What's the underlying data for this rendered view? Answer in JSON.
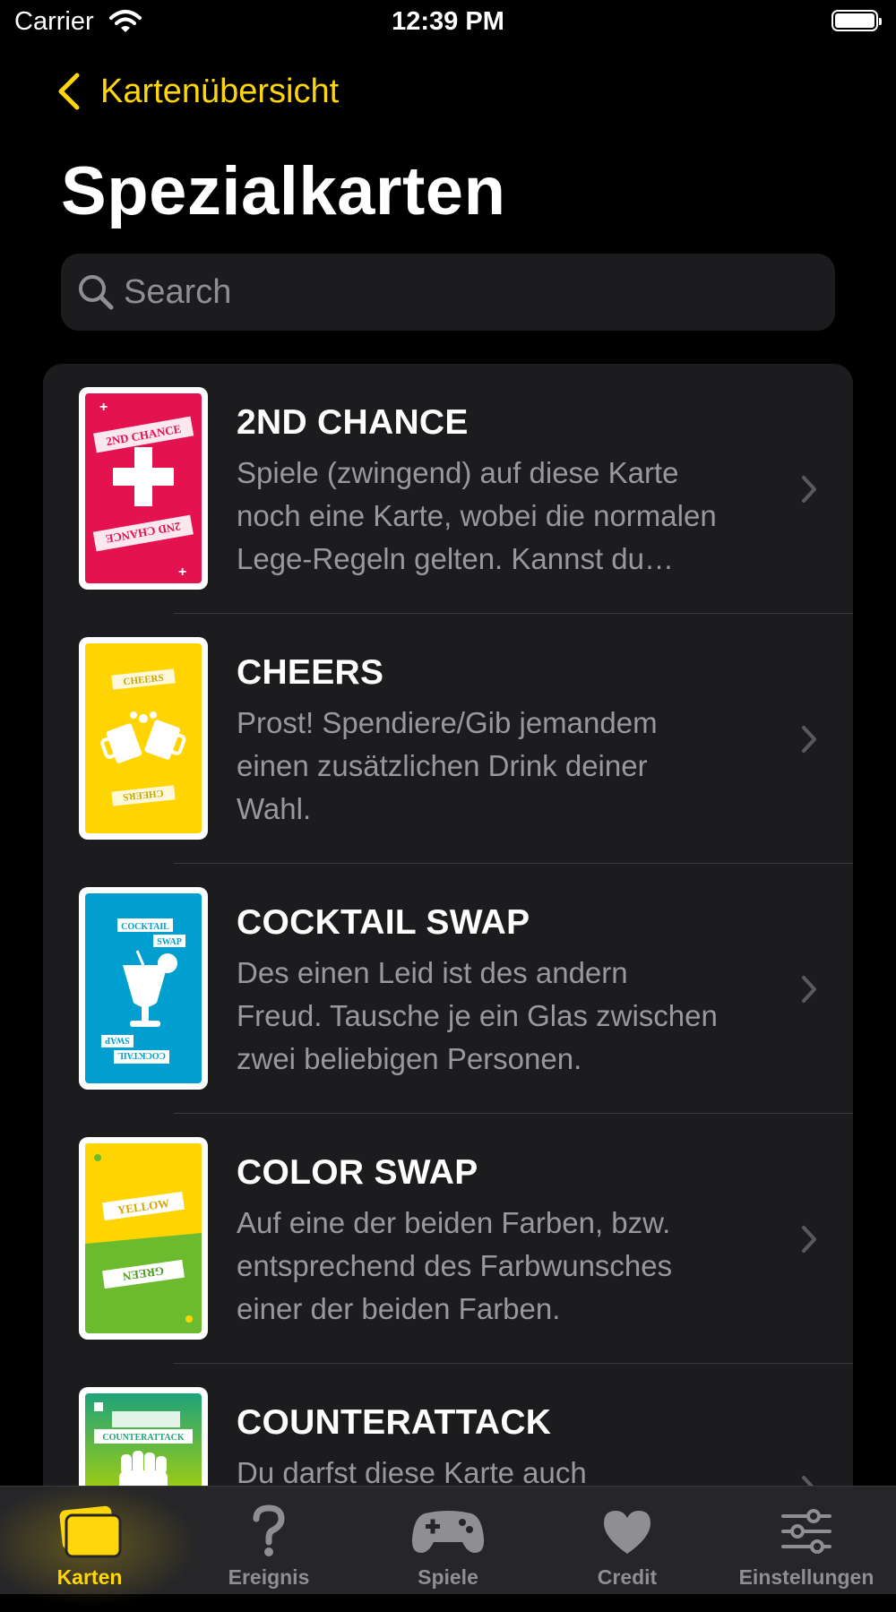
{
  "status_bar": {
    "carrier": "Carrier",
    "time": "12:39 PM"
  },
  "nav": {
    "back_label": "Kartenübersicht",
    "title": "Spezialkarten"
  },
  "search": {
    "placeholder": "Search"
  },
  "colors": {
    "accent": "#FFD60A"
  },
  "cards": [
    {
      "title": "2ND CHANCE",
      "description": "Spiele (zwingend) auf diese Karte noch eine Karte, wobei die normalen Lege-Regeln gelten. Kannst du…",
      "card_color": "#E4134F",
      "banner": "2ND CHANCE",
      "icon": "plus-icon"
    },
    {
      "title": "CHEERS",
      "description": "Prost! Spendiere/Gib jemandem einen zusätzlichen Drink deiner Wahl.",
      "card_color": "#FFD400",
      "banner": "CHEERS",
      "icon": "beer-mugs-icon"
    },
    {
      "title": "COCKTAIL SWAP",
      "description": "Des einen Leid ist des andern Freud. Tausche je ein Glas zwischen zwei beliebigen Personen.",
      "card_color": "#009FCF",
      "banner": "COCKTAIL",
      "banner2": "SWAP",
      "icon": "cocktail-icon"
    },
    {
      "title": "COLOR SWAP",
      "description": "Auf eine der beiden Farben, bzw. entsprechend des Farbwunsches einer der beiden Farben.",
      "card_color": "#FFD400",
      "card_color2": "#6CBB2E",
      "banner": "YELLOW",
      "banner2": "GREEN",
      "icon": "color-split-icon"
    },
    {
      "title": "COUNTERATTACK",
      "description": "Du darfst diese Karte auch",
      "card_color": "#1FA37A",
      "card_color2": "#B5D300",
      "banner": "COUNTERATTACK",
      "icon": "fist-icon"
    }
  ],
  "tabs": [
    {
      "label": "Karten",
      "icon": "cards-icon",
      "active": true
    },
    {
      "label": "Ereignis",
      "icon": "question-mark-icon",
      "active": false
    },
    {
      "label": "Spiele",
      "icon": "gamepad-icon",
      "active": false
    },
    {
      "label": "Credit",
      "icon": "heart-icon",
      "active": false
    },
    {
      "label": "Einstellungen",
      "icon": "sliders-icon",
      "active": false
    }
  ]
}
